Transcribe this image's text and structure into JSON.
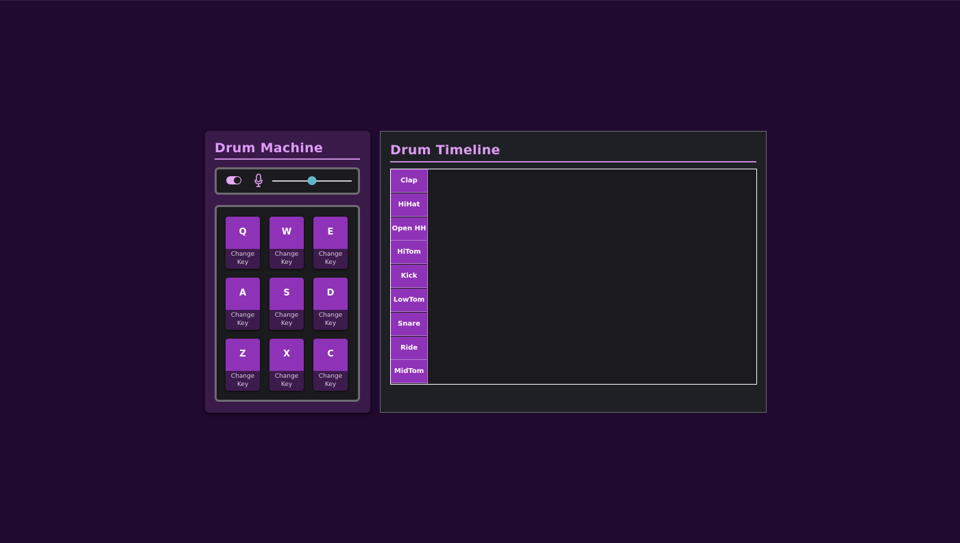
{
  "machine": {
    "title": "Drum Machine",
    "power_toggle_on": true,
    "volume": 0.5,
    "pads": [
      {
        "key": "Q",
        "change_label": "Change Key"
      },
      {
        "key": "W",
        "change_label": "Change Key"
      },
      {
        "key": "E",
        "change_label": "Change Key"
      },
      {
        "key": "A",
        "change_label": "Change Key"
      },
      {
        "key": "S",
        "change_label": "Change Key"
      },
      {
        "key": "D",
        "change_label": "Change Key"
      },
      {
        "key": "Z",
        "change_label": "Change Key"
      },
      {
        "key": "X",
        "change_label": "Change Key"
      },
      {
        "key": "C",
        "change_label": "Change Key"
      }
    ]
  },
  "timeline": {
    "title": "Drum Timeline",
    "tracks": [
      "Clap",
      "HiHat",
      "Open HH",
      "HiTom",
      "Kick",
      "LowTom",
      "Snare",
      "Ride",
      "MidTom"
    ]
  },
  "colors": {
    "background": "#200a2f",
    "accent": "#8e33b7",
    "title": "#dc9cf2",
    "slider_thumb": "#5fb7c7"
  },
  "icons": {
    "toggle": "toggle-icon",
    "mic": "microphone-icon"
  }
}
